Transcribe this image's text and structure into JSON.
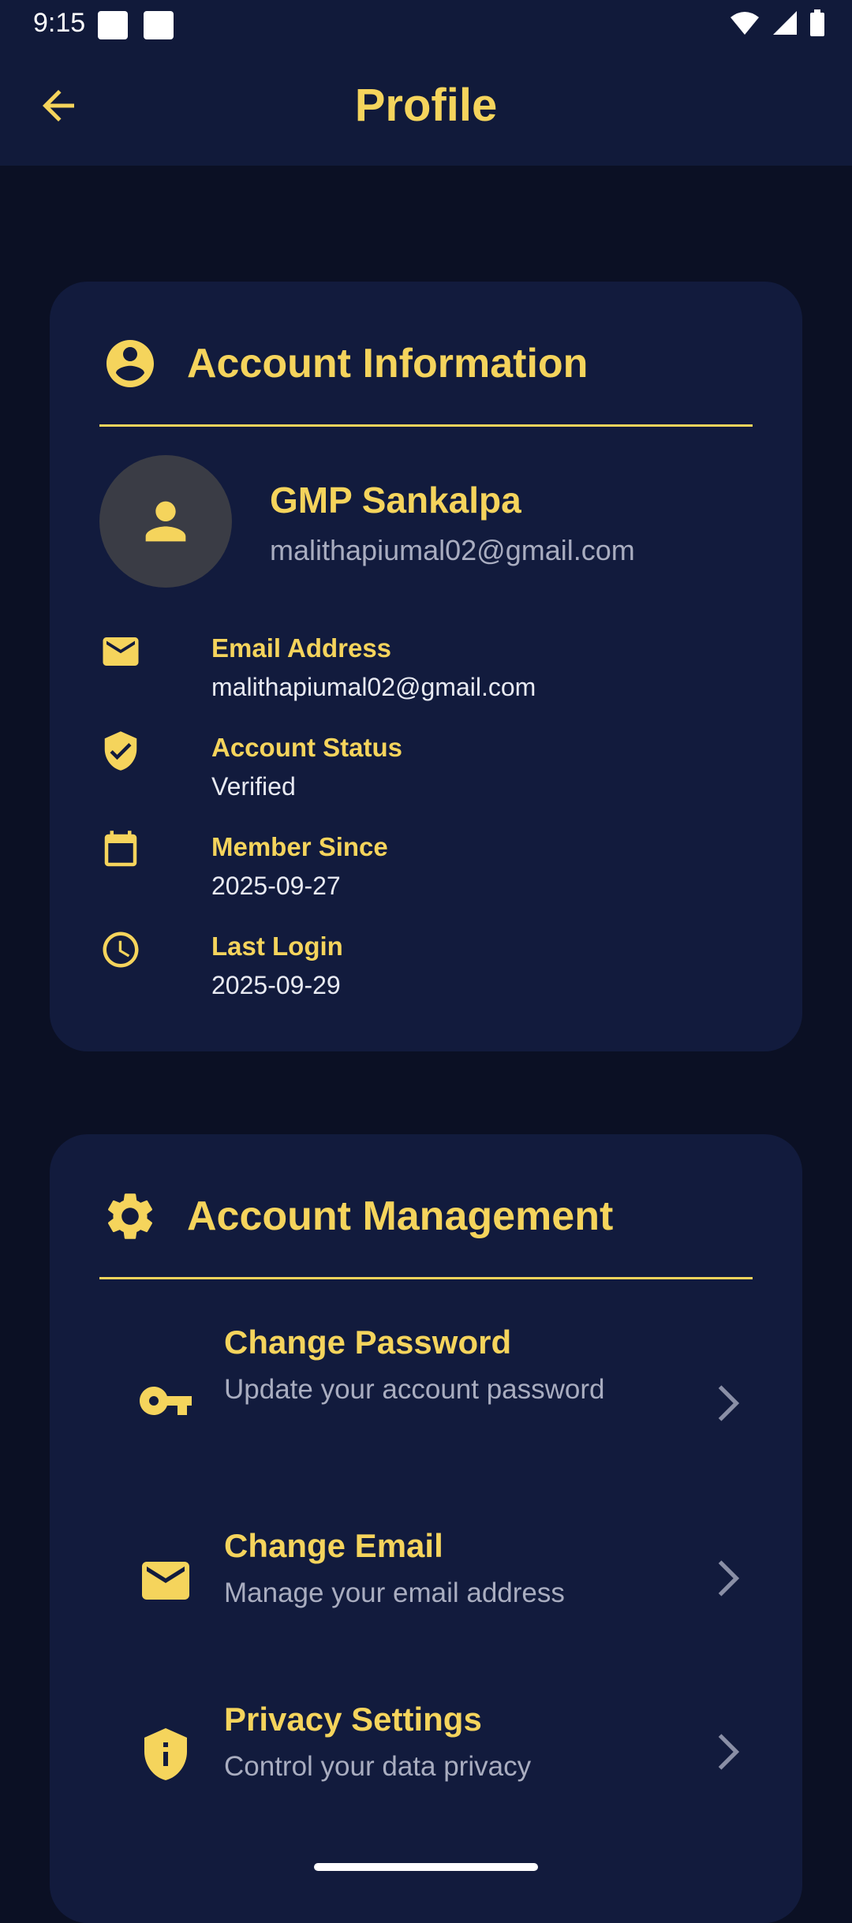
{
  "status_bar": {
    "time": "9:15"
  },
  "app_bar": {
    "title": "Profile"
  },
  "account_info": {
    "title": "Account Information",
    "user": {
      "name": "GMP Sankalpa",
      "email": "malithapiumal02@gmail.com"
    },
    "rows": [
      {
        "icon": "email-icon",
        "label": "Email Address",
        "value": "malithapiumal02@gmail.com"
      },
      {
        "icon": "verified-shield-icon",
        "label": "Account Status",
        "value": "Verified"
      },
      {
        "icon": "calendar-icon",
        "label": "Member Since",
        "value": "2025-09-27"
      },
      {
        "icon": "clock-icon",
        "label": "Last Login",
        "value": "2025-09-29"
      }
    ]
  },
  "account_management": {
    "title": "Account Management",
    "items": [
      {
        "icon": "key-icon",
        "title": "Change Password",
        "subtitle": "Update your account password"
      },
      {
        "icon": "email-icon",
        "title": "Change Email",
        "subtitle": "Manage your email address"
      },
      {
        "icon": "privacy-shield-icon",
        "title": "Privacy Settings",
        "subtitle": "Control your data privacy"
      }
    ]
  },
  "colors": {
    "accent": "#f5d45c",
    "background": "#0b1024",
    "card": "#121b3d",
    "app_bar": "#111a3a"
  }
}
